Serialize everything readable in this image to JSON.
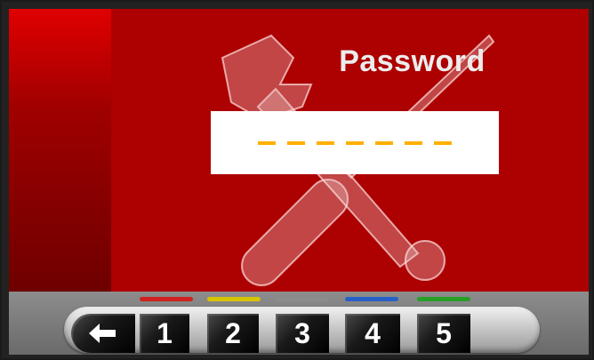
{
  "title": "Password",
  "password_mask": [
    "–",
    "–",
    "–",
    "–",
    "–",
    "–",
    "–"
  ],
  "keys": [
    {
      "label": "1",
      "led_color": "#d02020"
    },
    {
      "label": "2",
      "led_color": "#d6c400"
    },
    {
      "label": "3",
      "led_color": "#8c8c8c"
    },
    {
      "label": "4",
      "led_color": "#2860c8"
    },
    {
      "label": "5",
      "led_color": "#28a028"
    }
  ],
  "back_key": {
    "icon": "arrow-left-icon"
  },
  "colors": {
    "panel": "#ad0000",
    "mask_dash": "#ffb000"
  }
}
